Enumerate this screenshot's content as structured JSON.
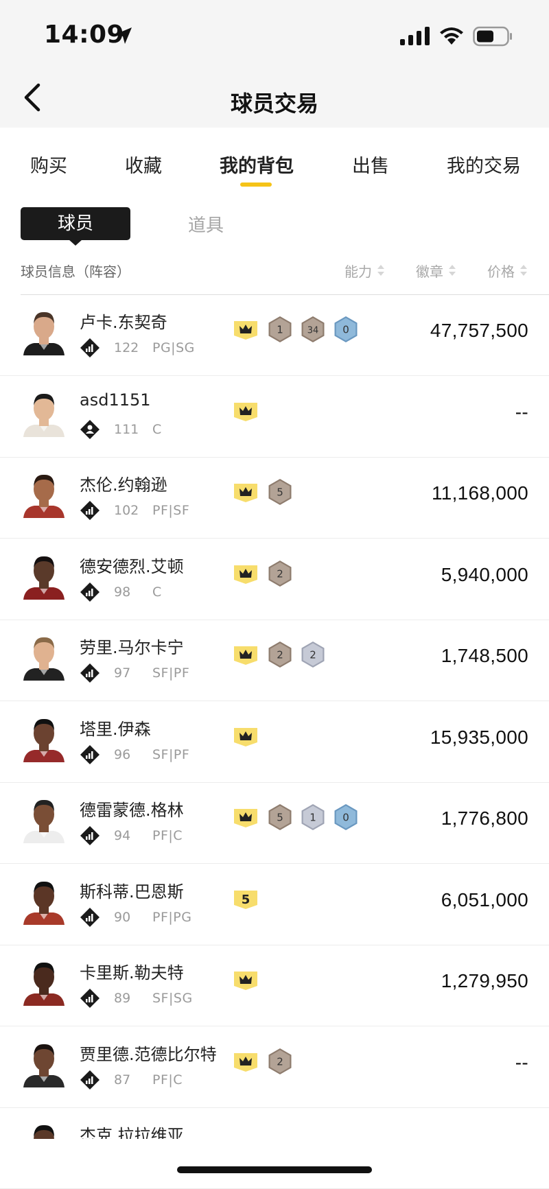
{
  "status_bar": {
    "time": "14:09"
  },
  "nav": {
    "title": "球员交易"
  },
  "tabs": [
    {
      "label": "购买",
      "active": false
    },
    {
      "label": "收藏",
      "active": false
    },
    {
      "label": "我的背包",
      "active": true
    },
    {
      "label": "出售",
      "active": false
    },
    {
      "label": "我的交易",
      "active": false
    }
  ],
  "segments": {
    "players": "球员",
    "items": "道具"
  },
  "columns": {
    "info": "球员信息（阵容）",
    "ability": "能力",
    "badge": "徽章",
    "price": "价格"
  },
  "colors": {
    "accent": "#f5c318",
    "crown_bg": "#f7dd6c",
    "bronze": "#b3a396",
    "silver": "#c6cad6",
    "blue": "#8fb9da"
  },
  "players": [
    {
      "name": "卢卡.东契奇",
      "rating": "122",
      "position": "PG|SG",
      "price": "47,757,500",
      "icon": "stats-icon",
      "tier": "crown",
      "badges": [
        [
          "bronze",
          "1"
        ],
        [
          "bronze",
          "34"
        ],
        [
          "blue",
          "0"
        ]
      ]
    },
    {
      "name": "asd1151",
      "rating": "111",
      "position": "C",
      "price": "--",
      "icon": "person-icon",
      "tier": "crown",
      "badges": []
    },
    {
      "name": "杰伦.约翰逊",
      "rating": "102",
      "position": "PF|SF",
      "price": "11,168,000",
      "icon": "stats-icon",
      "tier": "crown",
      "badges": [
        [
          "bronze",
          "5"
        ]
      ]
    },
    {
      "name": "德安德烈.艾顿",
      "rating": "98",
      "position": "C",
      "price": "5,940,000",
      "icon": "stats-icon",
      "tier": "crown",
      "badges": [
        [
          "bronze",
          "2"
        ]
      ]
    },
    {
      "name": "劳里.马尔卡宁",
      "rating": "97",
      "position": "SF|PF",
      "price": "1,748,500",
      "icon": "stats-icon",
      "tier": "crown",
      "badges": [
        [
          "bronze",
          "2"
        ],
        [
          "silver",
          "2"
        ]
      ]
    },
    {
      "name": "塔里.伊森",
      "rating": "96",
      "position": "SF|PF",
      "price": "15,935,000",
      "icon": "stats-icon",
      "tier": "crown",
      "badges": []
    },
    {
      "name": "德雷蒙德.格林",
      "rating": "94",
      "position": "PF|C",
      "price": "1,776,800",
      "icon": "stats-icon",
      "tier": "crown",
      "badges": [
        [
          "bronze",
          "5"
        ],
        [
          "silver",
          "1"
        ],
        [
          "blue",
          "0"
        ]
      ]
    },
    {
      "name": "斯科蒂.巴恩斯",
      "rating": "90",
      "position": "PF|PG",
      "price": "6,051,000",
      "icon": "stats-icon",
      "tier": "5",
      "badges": []
    },
    {
      "name": "卡里斯.勒夫特",
      "rating": "89",
      "position": "SF|SG",
      "price": "1,279,950",
      "icon": "stats-icon",
      "tier": "crown",
      "badges": []
    },
    {
      "name": "贾里德.范德比尔特",
      "rating": "87",
      "position": "PF|C",
      "price": "--",
      "icon": "stats-icon",
      "tier": "crown",
      "badges": [
        [
          "bronze",
          "2"
        ]
      ]
    },
    {
      "name": "杰克.拉拉维亚",
      "rating": "",
      "position": "",
      "price": "",
      "icon": "stats-icon",
      "tier": "",
      "badges": []
    }
  ]
}
